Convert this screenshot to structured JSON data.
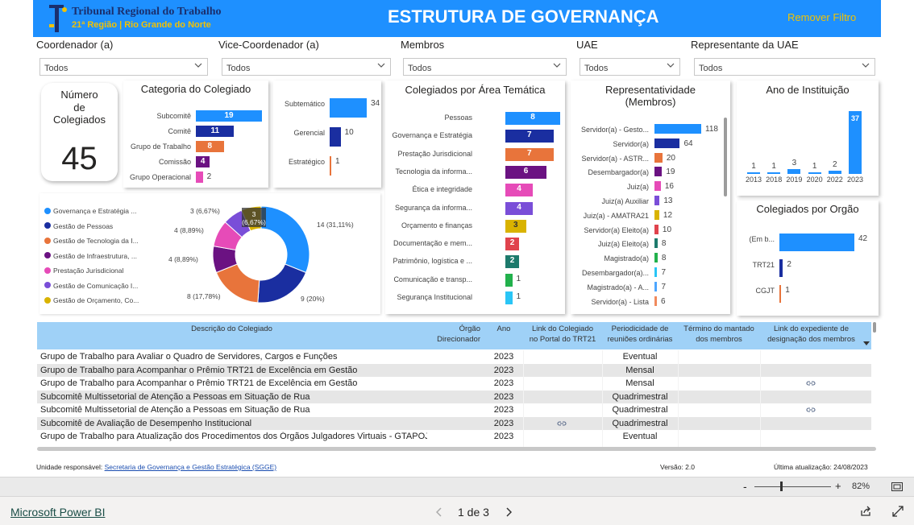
{
  "header": {
    "logo_line1": "Tribunal Regional do Trabalho",
    "logo_line2": "21ª Região | Rio Grande do Norte",
    "title": "ESTRUTURA DE GOVERNANÇA",
    "remove_filter": "Remover Filtro"
  },
  "slicers": [
    {
      "label": "Coordenador (a)",
      "value": "Todos"
    },
    {
      "label": "Vice-Coordenador (a)",
      "value": "Todos"
    },
    {
      "label": "Membros",
      "value": "Todos"
    },
    {
      "label": "UAE",
      "value": "Todos"
    },
    {
      "label": "Representante da UAE",
      "value": "Todos"
    }
  ],
  "kpi": {
    "label_l1": "Número",
    "label_l2": "de",
    "label_l3": "Colegiados",
    "value": "45"
  },
  "categoria": {
    "title": "Categoria do Colegiado",
    "items": [
      {
        "label": "Subcomitê",
        "value": 19,
        "color": "#1e90ff"
      },
      {
        "label": "Comitê",
        "value": 11,
        "color": "#1a2ea0"
      },
      {
        "label": "Grupo de Trabalho",
        "value": 8,
        "color": "#e8743b"
      },
      {
        "label": "Comissão",
        "value": 4,
        "color": "#6b1282"
      },
      {
        "label": "Grupo Operacional",
        "value": 2,
        "color": "#e64bb8"
      }
    ]
  },
  "nivel": {
    "items": [
      {
        "label": "Subtemático",
        "value": 34,
        "color": "#1e90ff"
      },
      {
        "label": "Gerencial",
        "value": 10,
        "color": "#1a2ea0"
      },
      {
        "label": "Estratégico",
        "value": 1,
        "color": "#e8743b"
      }
    ]
  },
  "area": {
    "title": "Colegiados por Área Temática",
    "items": [
      {
        "label": "Pessoas",
        "value": 8,
        "color": "#1e90ff"
      },
      {
        "label": "Governança e Estratégia",
        "value": 7,
        "color": "#1a2ea0"
      },
      {
        "label": "Prestação Jurisdicional",
        "value": 7,
        "color": "#e8743b"
      },
      {
        "label": "Tecnologia da informa...",
        "value": 6,
        "color": "#6b1282"
      },
      {
        "label": "Ética e integridade",
        "value": 4,
        "color": "#e64bb8"
      },
      {
        "label": "Segurança da informa...",
        "value": 4,
        "color": "#7a4ed8"
      },
      {
        "label": "Orçamento e finanças",
        "value": 3,
        "color": "#d9b300"
      },
      {
        "label": "Documentação e mem...",
        "value": 2,
        "color": "#e0434d"
      },
      {
        "label": "Patrimônio, logística e ...",
        "value": 2,
        "color": "#1d7a6c"
      },
      {
        "label": "Comunicação e transp...",
        "value": 1,
        "color": "#22b14c"
      },
      {
        "label": "Segurança Institucional",
        "value": 1,
        "color": "#29c5f6"
      }
    ]
  },
  "representatividade": {
    "title_l1": "Representatividade",
    "title_l2": "(Membros)",
    "items": [
      {
        "label": "Servidor(a) - Gesto...",
        "value": 118,
        "color": "#1e90ff"
      },
      {
        "label": "Servidor(a)",
        "value": 64,
        "color": "#1a2ea0"
      },
      {
        "label": "Servidor(a) - ASTR...",
        "value": 20,
        "color": "#e8743b"
      },
      {
        "label": "Desembargador(a)",
        "value": 19,
        "color": "#6b1282"
      },
      {
        "label": "Juiz(a)",
        "value": 16,
        "color": "#e64bb8"
      },
      {
        "label": "Juiz(a) Auxiliar",
        "value": 13,
        "color": "#7a4ed8"
      },
      {
        "label": "Juiz(a) - AMATRA21",
        "value": 12,
        "color": "#d9b300"
      },
      {
        "label": "Servidor(a) Eleito(a)",
        "value": 10,
        "color": "#e0434d"
      },
      {
        "label": "Juiz(a) Eleito(a)",
        "value": 8,
        "color": "#1d7a6c"
      },
      {
        "label": "Magistrado(a)",
        "value": 8,
        "color": "#22b14c"
      },
      {
        "label": "Desembargador(a)...",
        "value": 7,
        "color": "#29c5f6"
      },
      {
        "label": "Magistrado(a) - A...",
        "value": 7,
        "color": "#4da6ff"
      },
      {
        "label": "Servidor(a) - Lista",
        "value": 6,
        "color": "#f08a5d"
      }
    ]
  },
  "ano": {
    "title": "Ano de Instituição",
    "items": [
      {
        "label": "2013",
        "value": 1
      },
      {
        "label": "2018",
        "value": 1
      },
      {
        "label": "2019",
        "value": 3
      },
      {
        "label": "2020",
        "value": 1
      },
      {
        "label": "2022",
        "value": 2
      },
      {
        "label": "2023",
        "value": 37
      }
    ],
    "color": "#1e90ff"
  },
  "orgao": {
    "title": "Colegiados por Orgão",
    "items": [
      {
        "label": "(Em b...",
        "value": 42,
        "color": "#1e90ff"
      },
      {
        "label": "TRT21",
        "value": 2,
        "color": "#1a2ea0"
      },
      {
        "label": "CGJT",
        "value": 1,
        "color": "#e8743b"
      }
    ]
  },
  "donut": {
    "legend": [
      {
        "label": "Governança e Estratégia ...",
        "color": "#1e90ff"
      },
      {
        "label": "Gestão de Pessoas",
        "color": "#1a2ea0"
      },
      {
        "label": "Gestão de Tecnologia da I...",
        "color": "#e8743b"
      },
      {
        "label": "Gestão de Infraestrutura, ...",
        "color": "#6b1282"
      },
      {
        "label": "Prestação Jurisdicional",
        "color": "#e64bb8"
      },
      {
        "label": "Gestão de Comunicação I...",
        "color": "#7a4ed8"
      },
      {
        "label": "Gestão de Orçamento, Co...",
        "color": "#d9b300"
      }
    ],
    "slices": [
      {
        "value": 14,
        "label": "14 (31,11%)",
        "color": "#1e90ff"
      },
      {
        "value": 9,
        "label": "9 (20%)",
        "color": "#1a2ea0"
      },
      {
        "value": 8,
        "label": "8 (17,78%)",
        "color": "#e8743b"
      },
      {
        "value": 4,
        "label": "4 (8,89%)",
        "color": "#6b1282"
      },
      {
        "value": 4,
        "label": "4 (8,89%)",
        "color": "#e64bb8"
      },
      {
        "value": 3,
        "label": "3 (6,67%)",
        "color": "#7a4ed8"
      },
      {
        "value": 3,
        "label": "3 (6,67%)",
        "color": "#d9b300"
      }
    ]
  },
  "table": {
    "headers": {
      "descricao": "Descrição do Colegiado",
      "orgao_l1": "Órgão",
      "orgao_l2": "Direcionador",
      "ano": "Ano",
      "link_l1": "Link do Colegiado",
      "link_l2": "no Portal do TRT21",
      "period_l1": "Periodicidade de",
      "period_l2": "reuniões ordinárias",
      "termino_l1": "Término do mantado",
      "termino_l2": "dos membros",
      "exped_l1": "Link do expediente de",
      "exped_l2": "designação dos membros"
    },
    "rows": [
      {
        "desc": "Grupo de Trabalho para Avaliar o Quadro de Servidores, Cargos e Funções",
        "ano": "2023",
        "period": "Eventual",
        "link": false,
        "exped": false
      },
      {
        "desc": "Grupo de Trabalho para Acompanhar o Prêmio TRT21 de Excelência em Gestão",
        "ano": "2023",
        "period": "Mensal",
        "link": false,
        "exped": false
      },
      {
        "desc": "Grupo de Trabalho para Acompanhar o Prêmio TRT21 de Excelência em Gestão",
        "ano": "2023",
        "period": "Mensal",
        "link": false,
        "exped": true
      },
      {
        "desc": "Subcomitê Multissetorial de Atenção a Pessoas em Situação de Rua",
        "ano": "2023",
        "period": "Quadrimestral",
        "link": false,
        "exped": false
      },
      {
        "desc": "Subcomitê Multissetorial de Atenção a Pessoas em Situação de Rua",
        "ano": "2023",
        "period": "Quadrimestral",
        "link": false,
        "exped": true
      },
      {
        "desc": "Subcomitê de Avaliação de Desempenho Institucional",
        "ano": "2023",
        "period": "Quadrimestral",
        "link": true,
        "exped": false
      },
      {
        "desc": "Grupo de Trabalho para Atualização dos Procedimentos dos Órgãos Julgadores Virtuais - GTAPOJV",
        "ano": "2023",
        "period": "Eventual",
        "link": false,
        "exped": false
      }
    ]
  },
  "footer": {
    "unidade_prefix": "Unidade responsável: ",
    "unidade_link": "Secretaria de Governança e Gestão Estratégica (SGGE)",
    "versao": "Versão: 2.0",
    "atualizacao": "Última atualização: 24/08/2023"
  },
  "pbi": {
    "zoom": "82%",
    "brand": "Microsoft Power BI",
    "page": "1 de 3"
  }
}
